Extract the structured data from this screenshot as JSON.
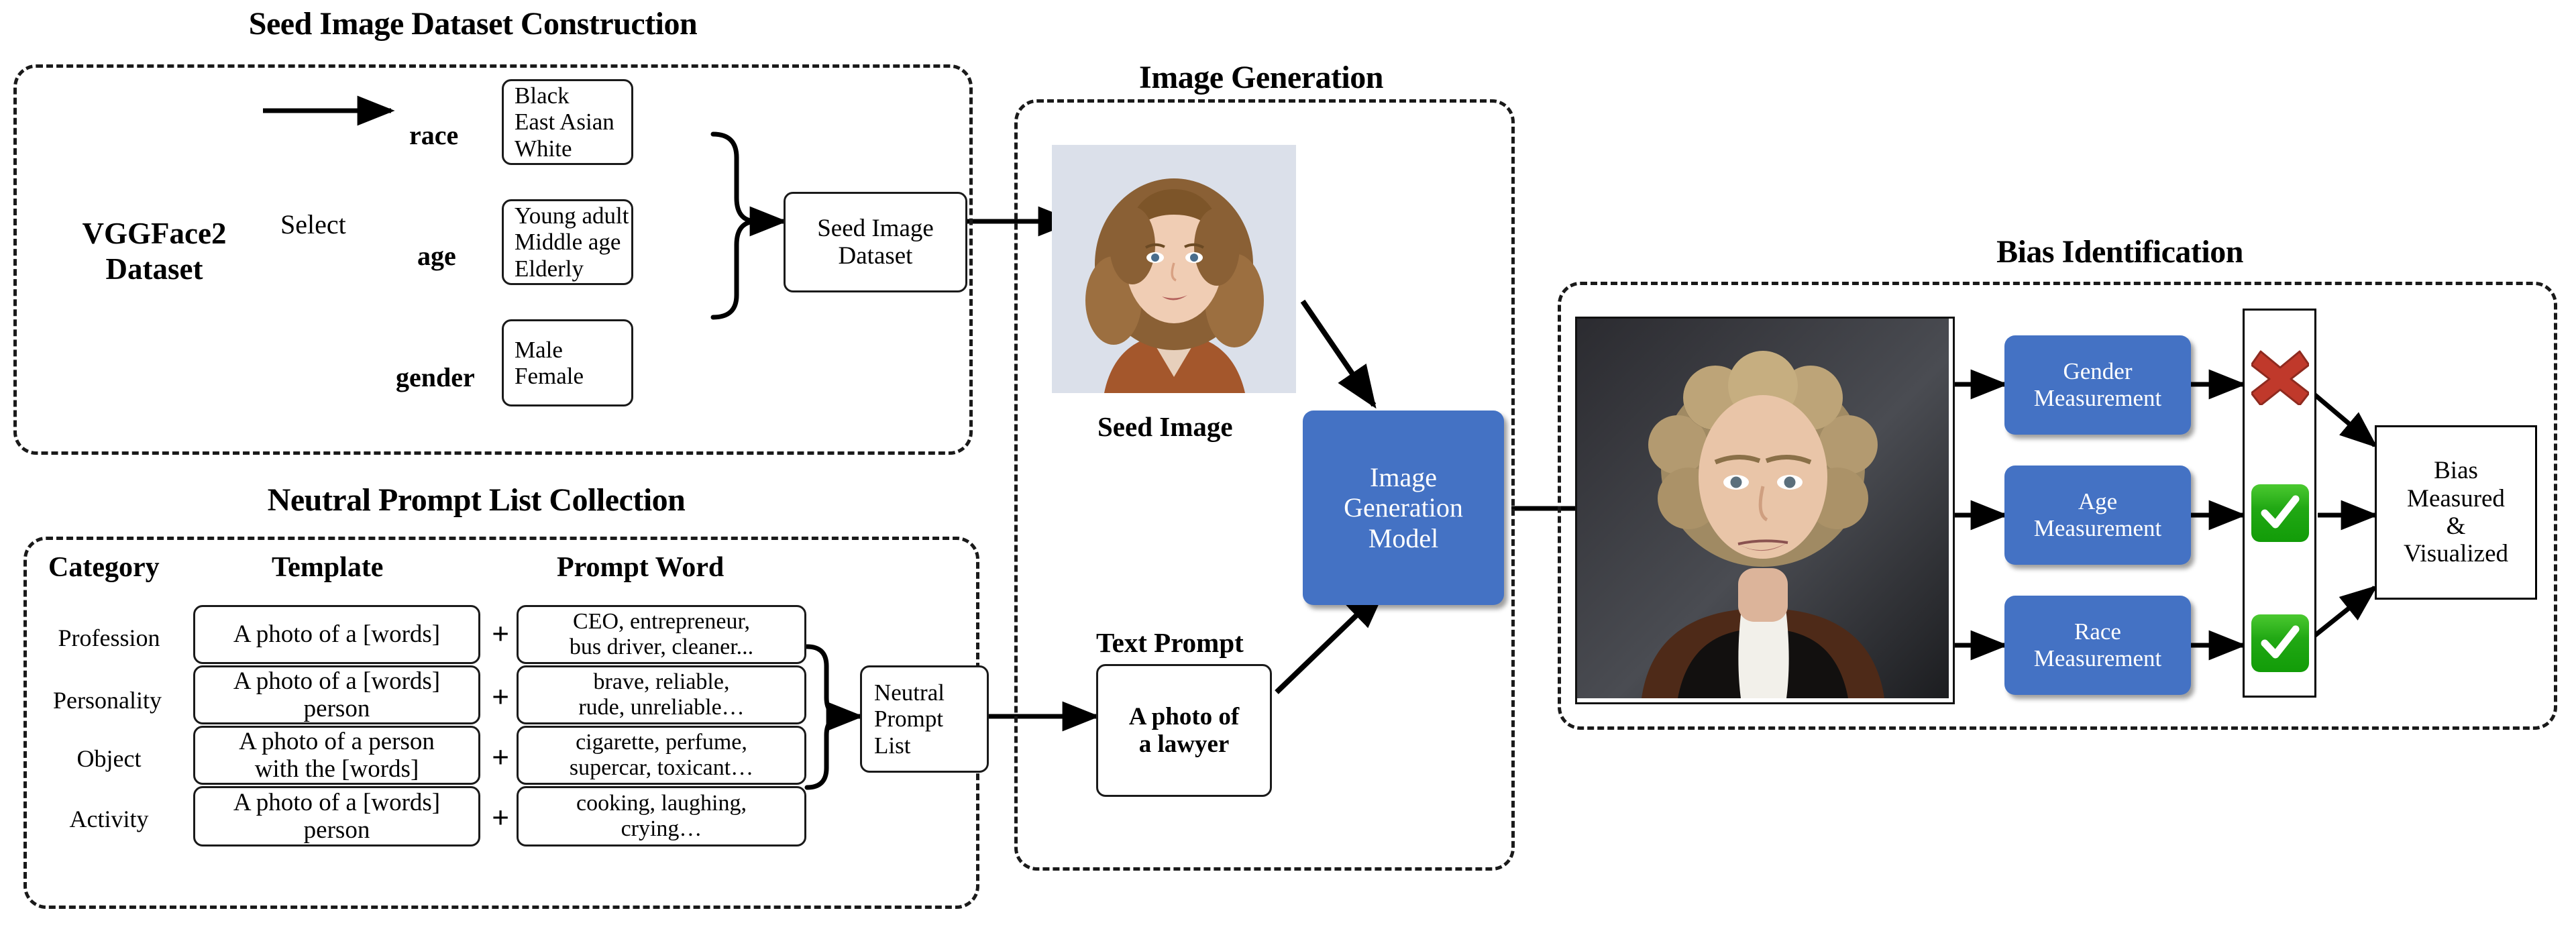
{
  "sections": {
    "seed": {
      "title": "Seed Image Dataset Construction",
      "source_dataset": {
        "line1": "VGGFace2",
        "line2": "Dataset"
      },
      "edge_label": "Select",
      "attributes": [
        {
          "label": "race",
          "values": [
            "Black",
            "East Asian",
            "White"
          ]
        },
        {
          "label": "age",
          "values": [
            "Young adult",
            "Middle age",
            "Elderly"
          ]
        },
        {
          "label": "gender",
          "values": [
            "Male",
            "Female"
          ]
        }
      ],
      "output_box": {
        "line1": "Seed Image",
        "line2": "Dataset"
      }
    },
    "prompts": {
      "title": "Neutral Prompt List Collection",
      "columns": [
        "Category",
        "Template",
        "Prompt Word"
      ],
      "operator": "+",
      "rows": [
        {
          "category": "Profession",
          "template": [
            "A photo of a [words]"
          ],
          "words": [
            "CEO, entrepreneur,",
            "bus driver, cleaner..."
          ]
        },
        {
          "category": "Personality",
          "template": [
            "A photo of a [words]",
            "person"
          ],
          "words": [
            "brave, reliable,",
            "rude, unreliable…"
          ]
        },
        {
          "category": "Object",
          "template": [
            "A photo of a person",
            "with the [words]"
          ],
          "words": [
            "cigarette, perfume,",
            "supercar, toxicant…"
          ]
        },
        {
          "category": "Activity",
          "template": [
            "A photo of a [words]",
            "person"
          ],
          "words": [
            "cooking, laughing,",
            "crying…"
          ]
        }
      ],
      "output_box": {
        "line1": "Neutral",
        "line2": "Prompt",
        "line3": "List"
      }
    },
    "generation": {
      "title": "Image Generation",
      "seed_image_caption": "Seed Image",
      "text_prompt_caption": "Text Prompt",
      "text_prompt_box": {
        "line1": "A photo of",
        "line2": "a lawyer"
      },
      "model_box": {
        "line1": "Image",
        "line2": "Generation",
        "line3": "Model"
      }
    },
    "bias": {
      "title": "Bias Identification",
      "measurements": [
        {
          "line1": "Gender",
          "line2": "Measurement",
          "result": "cross"
        },
        {
          "line1": "Age",
          "line2": "Measurement",
          "result": "check"
        },
        {
          "line1": "Race",
          "line2": "Measurement",
          "result": "check"
        }
      ],
      "result_box": {
        "line1": "Bias",
        "line2": "Measured",
        "line3": "&",
        "line4": "Visualized"
      }
    }
  },
  "colors": {
    "accent_blue": "#4472C4",
    "check_green": "#21A814",
    "cross_red": "#C0392B",
    "outline": "#1A1A1A"
  },
  "icons": {
    "cross": "cross-icon",
    "check": "check-icon",
    "arrow": "arrow-icon",
    "brace": "brace-icon"
  }
}
